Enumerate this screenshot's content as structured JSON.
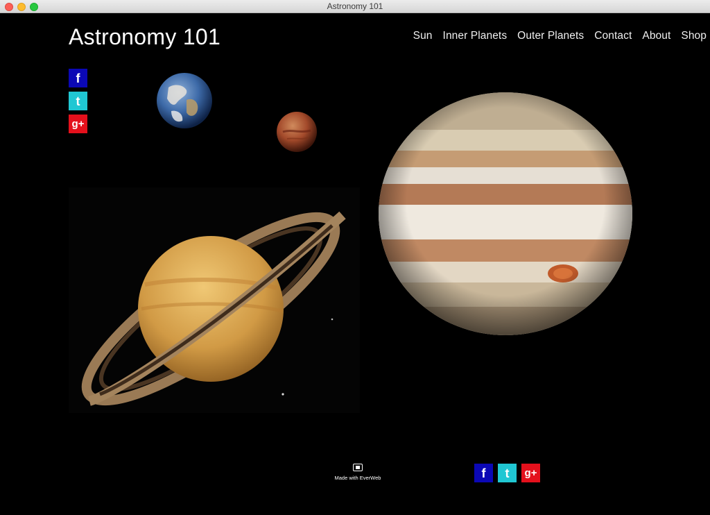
{
  "window": {
    "title": "Astronomy 101"
  },
  "site": {
    "title": "Astronomy 101"
  },
  "nav": {
    "items": [
      {
        "label": "Sun"
      },
      {
        "label": "Inner Planets"
      },
      {
        "label": "Outer Planets"
      },
      {
        "label": "Contact"
      },
      {
        "label": "About"
      },
      {
        "label": "Shop"
      }
    ]
  },
  "social": {
    "facebook_glyph": "f",
    "twitter_glyph": "t",
    "googleplus_glyph": "g+"
  },
  "footer": {
    "made_with": "Made with EverWeb"
  },
  "colors": {
    "facebook": "#0b08b5",
    "twitter": "#20c7d3",
    "googleplus": "#e4101c",
    "background": "#000000"
  }
}
